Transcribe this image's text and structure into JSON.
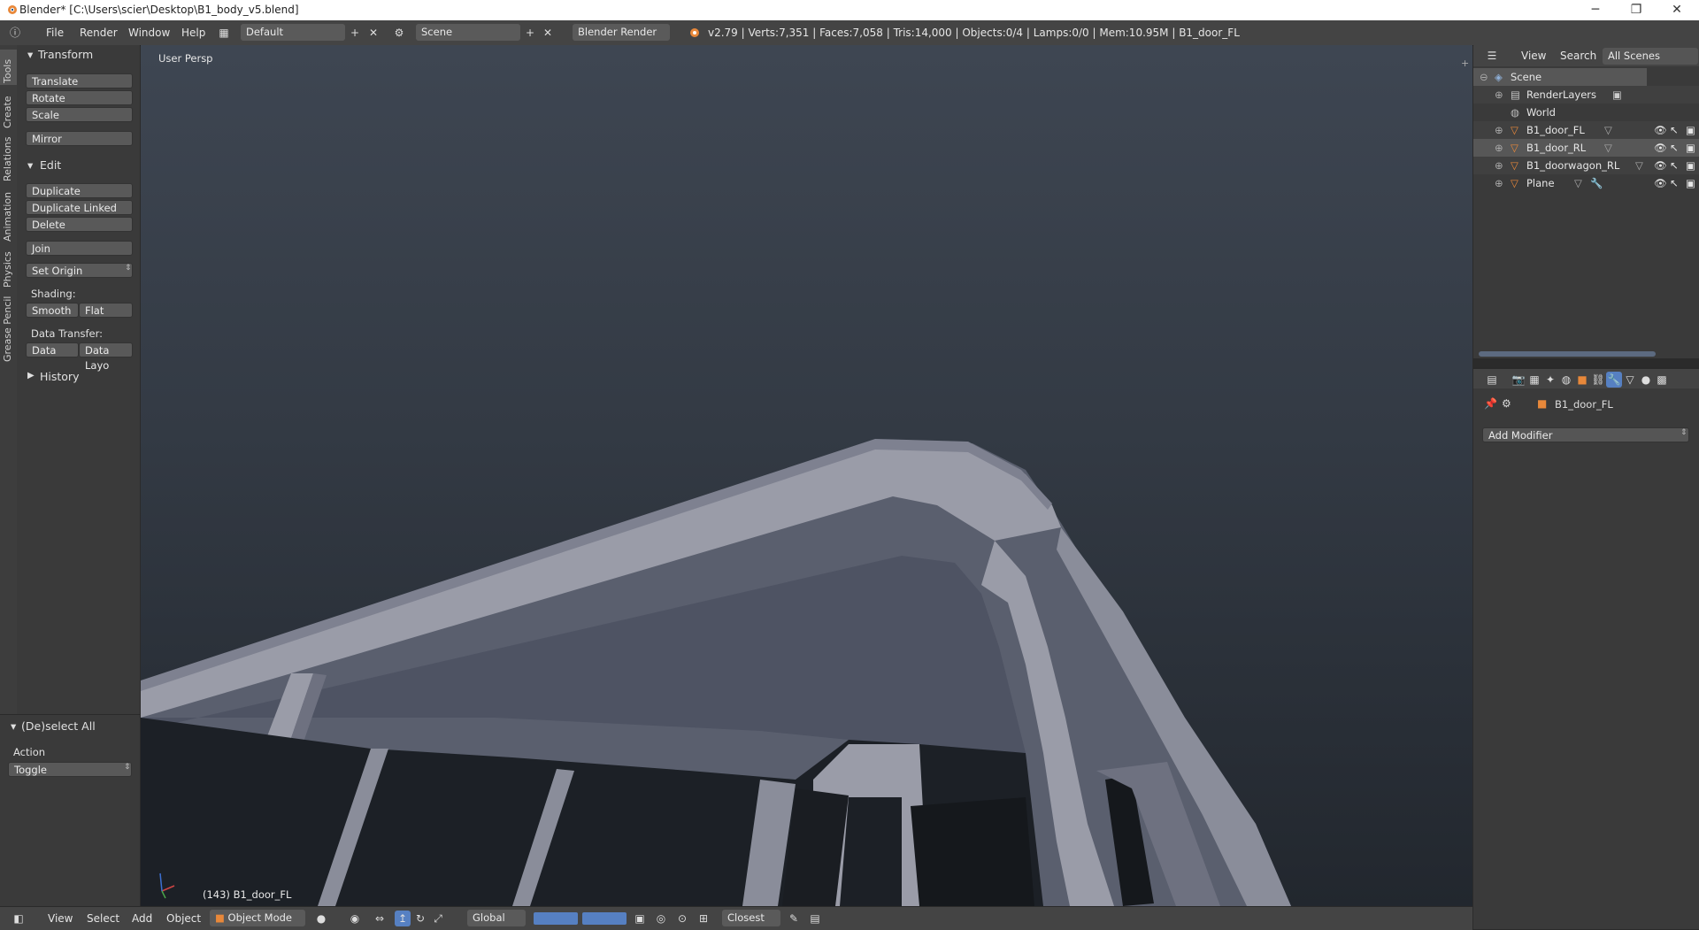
{
  "window": {
    "title": "Blender* [C:\\Users\\scier\\Desktop\\B1_body_v5.blend]",
    "controls": [
      "─",
      "❐",
      "✕"
    ]
  },
  "info_header": {
    "menus": [
      "File",
      "Render",
      "Window",
      "Help"
    ],
    "screen_layout": "Default",
    "scene": "Scene",
    "render_engine": "Blender Render",
    "stats": "v2.79 | Verts:7,351 | Faces:7,058 | Tris:14,000 | Objects:0/4 | Lamps:0/0 | Mem:10.95M | B1_door_FL"
  },
  "left_tabs": [
    "Tools",
    "Create",
    "Relations",
    "Animation",
    "Physics",
    "Grease Pencil"
  ],
  "tool_shelf": {
    "transform_header": "Transform",
    "transform_buttons": [
      "Translate",
      "Rotate",
      "Scale"
    ],
    "mirror": "Mirror",
    "edit_header": "Edit",
    "edit_buttons": [
      "Duplicate",
      "Duplicate Linked",
      "Delete"
    ],
    "join": "Join",
    "set_origin": "Set Origin",
    "shading_label": "Shading:",
    "smooth": "Smooth",
    "flat": "Flat",
    "data_transfer_label": "Data Transfer:",
    "data": "Data",
    "data_layout": "Data Layo",
    "history_header": "History"
  },
  "redo_panel": {
    "header": "(De)select All",
    "action_label": "Action",
    "action_value": "Toggle"
  },
  "viewport": {
    "view_name": "User Persp",
    "object_info": "(143) B1_door_FL"
  },
  "viewport_header": {
    "menus": [
      "View",
      "Select",
      "Add",
      "Object"
    ],
    "mode": "Object Mode",
    "orientation": "Global",
    "snap_target": "Closest"
  },
  "outliner": {
    "header_menus": [
      "View",
      "Search"
    ],
    "display_mode": "All Scenes",
    "items": [
      {
        "name": "Scene",
        "level": 0
      },
      {
        "name": "RenderLayers",
        "level": 1
      },
      {
        "name": "World",
        "level": 1
      },
      {
        "name": "B1_door_FL",
        "level": 1
      },
      {
        "name": "B1_door_RL",
        "level": 1
      },
      {
        "name": "B1_doorwagon_RL",
        "level": 1
      },
      {
        "name": "Plane",
        "level": 1
      }
    ]
  },
  "properties": {
    "object_name": "B1_door_FL",
    "add_modifier": "Add Modifier"
  },
  "colors": {
    "ui_bg": "#3a3a3a",
    "header_bg": "#444444",
    "button_bg": "#595959",
    "viewport_top": "#3e4652",
    "viewport_bottom": "#22272e",
    "mesh": "#9a9ca8",
    "accent_orange": "#e8883a"
  }
}
